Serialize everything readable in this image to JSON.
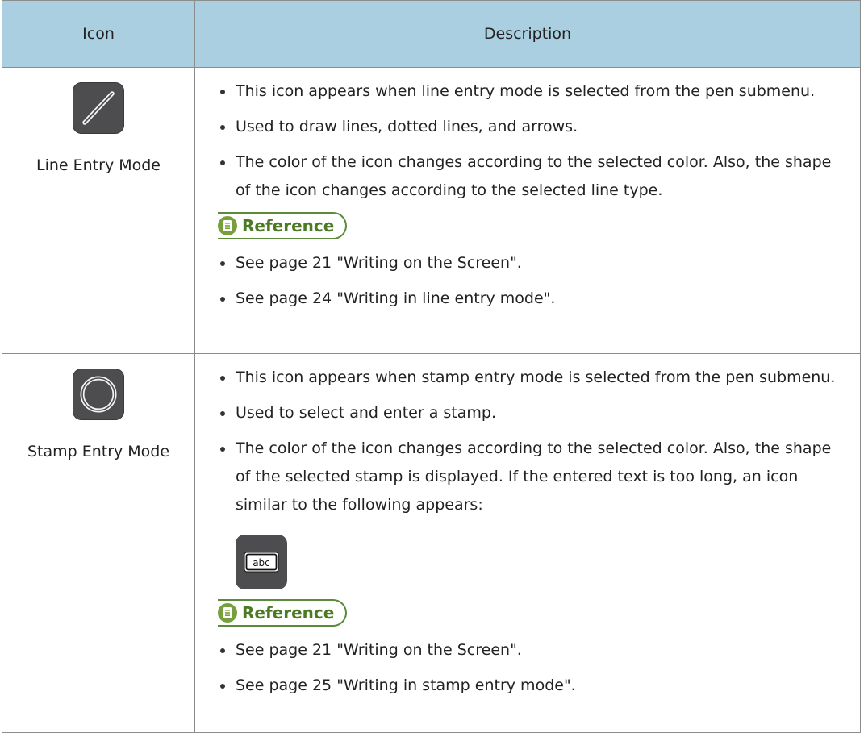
{
  "table": {
    "headers": {
      "icon": "Icon",
      "description": "Description"
    },
    "rows": [
      {
        "icon_name": "line-entry-mode-icon",
        "icon_label": "Line Entry Mode",
        "bullets": [
          "This icon appears when line entry mode is selected from the pen submenu.",
          "Used to draw lines, dotted lines, and arrows.",
          "The color of the icon changes according to the selected color. Also, the shape of the icon changes according to the selected line type."
        ],
        "reference_label": "Reference",
        "references": [
          "See page 21 \"Writing on the Screen\".",
          "See page 24 \"Writing in line entry mode\"."
        ]
      },
      {
        "icon_name": "stamp-entry-mode-icon",
        "icon_label": "Stamp Entry Mode",
        "bullets": [
          "This icon appears when stamp entry mode is selected from the pen submenu.",
          "Used to select and enter a stamp.",
          "The color of the icon changes according to the selected color. Also, the shape of the selected stamp is displayed. If the entered text is too long, an icon similar to the following appears:"
        ],
        "inline_icon_name": "abc-stamp-icon",
        "inline_icon_text": "abc",
        "reference_label": "Reference",
        "references": [
          "See page 21 \"Writing on the Screen\".",
          "See page 25 \"Writing in stamp entry mode\"."
        ]
      }
    ]
  },
  "colors": {
    "header_bg": "#a9cfe0",
    "icon_bg": "#4d4d4f",
    "reference_green": "#77a03c",
    "border": "#8c8c8c"
  }
}
